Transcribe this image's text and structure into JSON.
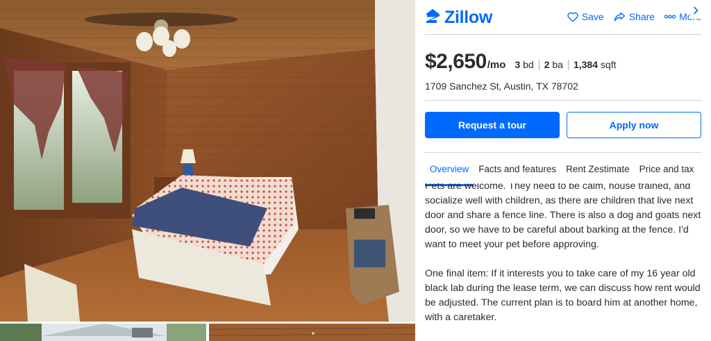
{
  "brand": {
    "name": "Zillow",
    "color": "#006aff"
  },
  "header_actions": [
    {
      "label": "Save",
      "icon": "heart-icon"
    },
    {
      "label": "Share",
      "icon": "share-icon"
    },
    {
      "label": "More",
      "icon": "more-dots-icon"
    }
  ],
  "listing": {
    "price": "$2,650",
    "period": "/mo",
    "beds": "3",
    "beds_label": "bd",
    "baths": "2",
    "baths_label": "ba",
    "sqft": "1,384",
    "sqft_label": "sqft",
    "address": "1709 Sanchez St, Austin, TX 78702"
  },
  "buttons": {
    "primary": "Request a tour",
    "secondary": "Apply now"
  },
  "tabs": [
    "Overview",
    "Facts and features",
    "Rent Zestimate",
    "Price and tax"
  ],
  "active_tab": "Overview",
  "description": [
    "Pets are welcome. They need to be calm, house trained, and socialize well with children, as there are children that live next door and share a fence line. There is also a dog and goats next door, so we have to be careful about barking at the fence. I'd want to meet your pet before approving.",
    "One final item: If it interests you to take care of my 16 year old black lab during the lease term, we can discuss how rent would be adjusted. The current plan is to board him at another home, with a caretaker."
  ],
  "photos": {
    "main": "bedroom-photo",
    "thumbnails": [
      "house-exterior-photo",
      "interior-ceiling-photo"
    ]
  }
}
